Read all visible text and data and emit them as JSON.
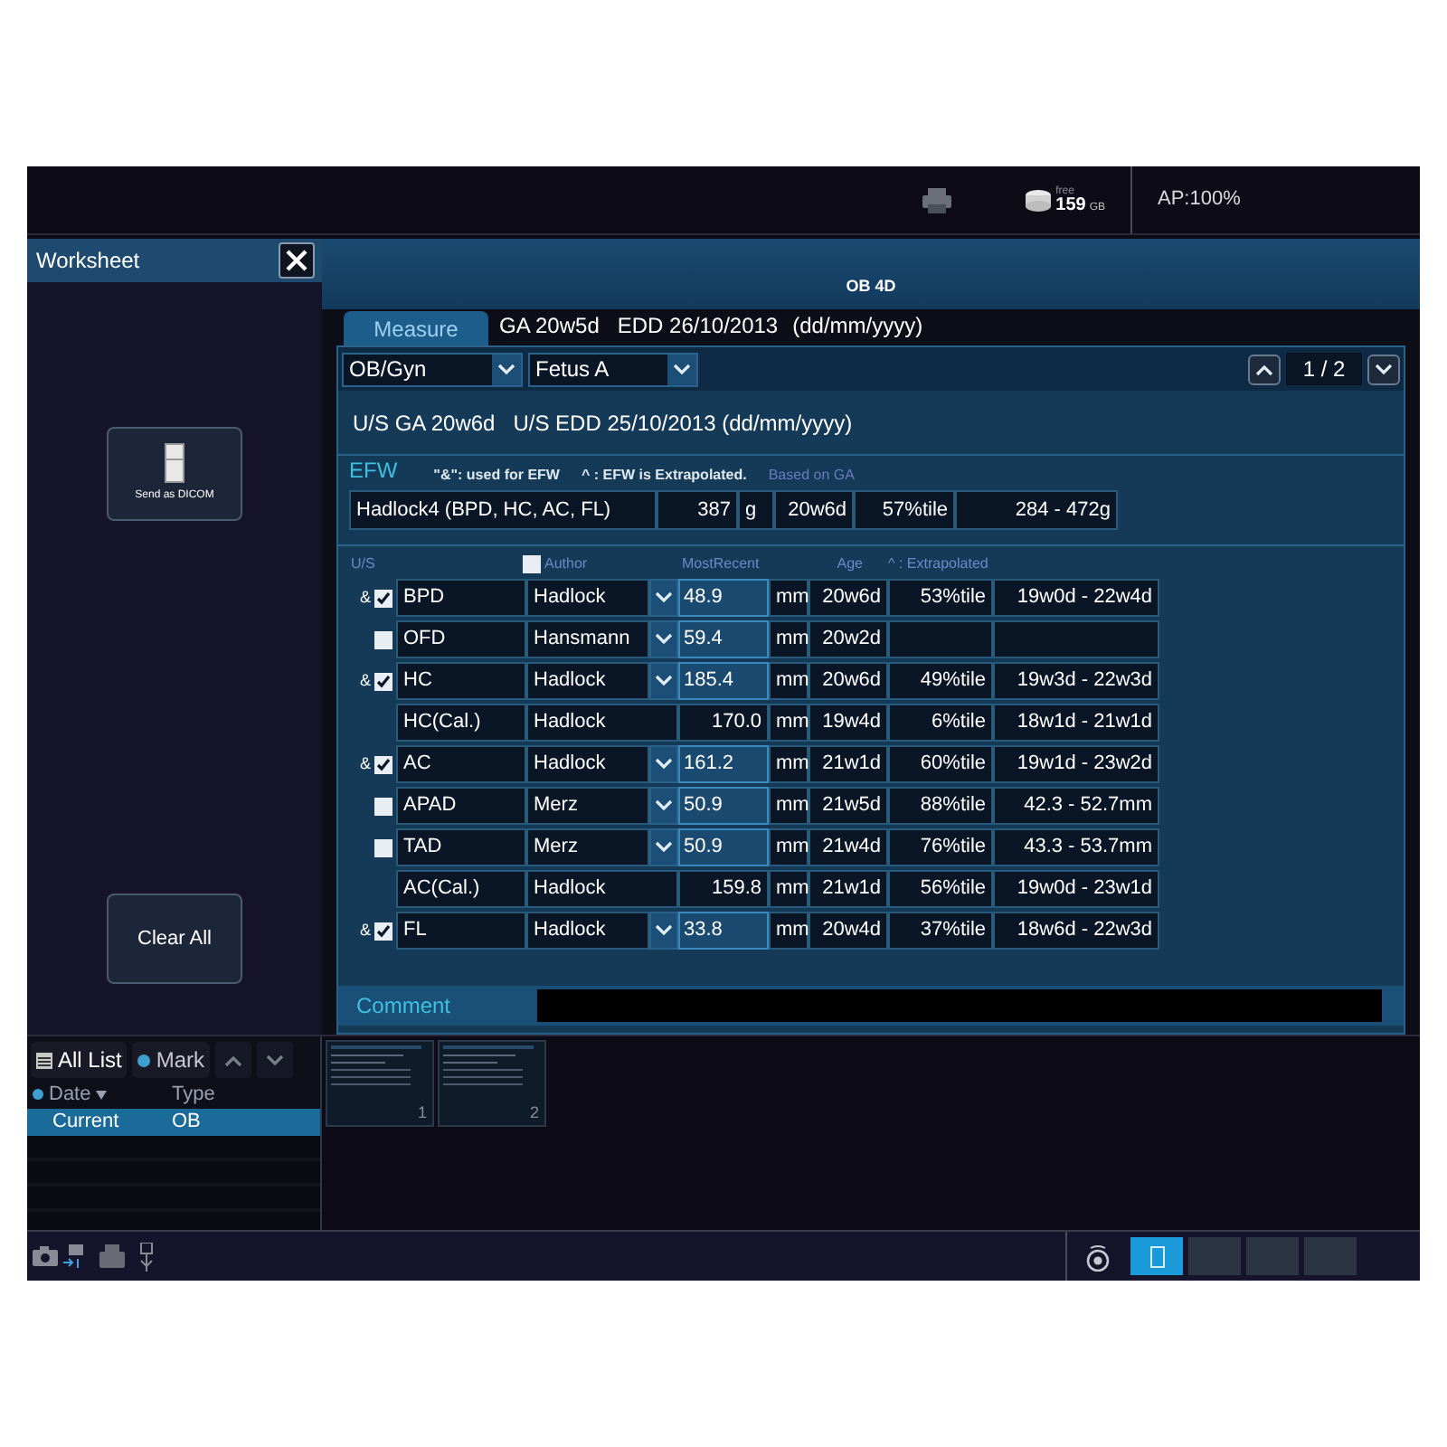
{
  "top_bar": {
    "storage_label": "free",
    "storage_value": "159",
    "storage_unit": "GB",
    "power": "AP:100%"
  },
  "worksheet": {
    "title": "Worksheet",
    "send_button": "Send as DICOM",
    "clear_button": "Clear All"
  },
  "history": {
    "all_list": "All List",
    "mark": "Mark",
    "columns": [
      "Date",
      "Type"
    ],
    "rows": [
      {
        "date": "Current",
        "type": "OB",
        "selected": true
      }
    ]
  },
  "thumbnails": [
    {
      "number": "1",
      "selected": false
    },
    {
      "number": "2",
      "selected": false
    }
  ],
  "main": {
    "title": "OB 4D",
    "tab": {
      "label": "Measure",
      "selected": true
    },
    "ga": "GA 20w5d",
    "edd": "EDD 26/10/2013",
    "date_format": "(dd/mm/yyyy)",
    "dropdowns": [
      "OB/Gyn",
      "Fetus A"
    ],
    "page": "1 / 2",
    "us_line": "U/S GA 20w6d   U/S EDD 25/10/2013 (dd/mm/yyyy)",
    "efw": {
      "title": "EFW",
      "note_used": "\"&\": used for EFW",
      "note_extrapolated": "^ : EFW is Extrapolated.",
      "basis": "Based on GA",
      "row": {
        "method": "Hadlock4 (BPD, HC, AC, FL)",
        "value": "387",
        "unit": "g",
        "age": "20w6d",
        "percentile": "57%tile",
        "range": "284 - 472g"
      }
    },
    "table": {
      "headers": {
        "us": "U/S",
        "author": "Author",
        "author_checked": false,
        "recent": "MostRecent",
        "age": "Age",
        "extrapolated": "^ : Extrapolated"
      },
      "rows": [
        {
          "kind": "measured",
          "mark": "&",
          "checked": true,
          "name": "BPD",
          "author": "Hadlock",
          "value": "48.9",
          "unit": "mm",
          "age": "20w6d",
          "percentile": "53%tile",
          "range": "19w0d - 22w4d"
        },
        {
          "kind": "measured",
          "checked": false,
          "name": "OFD",
          "author": "Hansmann",
          "value": "59.4",
          "unit": "mm",
          "age": "20w2d"
        },
        {
          "kind": "measured",
          "mark": "&",
          "checked": true,
          "name": "HC",
          "author": "Hadlock",
          "value": "185.4",
          "unit": "mm",
          "age": "20w6d",
          "percentile": "49%tile",
          "range": "19w3d - 22w3d"
        },
        {
          "kind": "calculated",
          "name": "HC(Cal.)",
          "author": "Hadlock",
          "value": "170.0",
          "unit": "mm",
          "age": "19w4d",
          "percentile": "6%tile",
          "range": "18w1d - 21w1d"
        },
        {
          "kind": "measured",
          "mark": "&",
          "checked": true,
          "name": "AC",
          "author": "Hadlock",
          "value": "161.2",
          "unit": "mm",
          "age": "21w1d",
          "percentile": "60%tile",
          "range": "19w1d - 23w2d"
        },
        {
          "kind": "measured",
          "checked": false,
          "name": "APAD",
          "author": "Merz",
          "value": "50.9",
          "unit": "mm",
          "age": "21w5d",
          "percentile": "88%tile",
          "range": "42.3 - 52.7mm"
        },
        {
          "kind": "measured",
          "checked": false,
          "name": "TAD",
          "author": "Merz",
          "value": "50.9",
          "unit": "mm",
          "age": "21w4d",
          "percentile": "76%tile",
          "range": "43.3 - 53.7mm"
        },
        {
          "kind": "calculated",
          "name": "AC(Cal.)",
          "author": "Hadlock",
          "value": "159.8",
          "unit": "mm",
          "age": "21w1d",
          "percentile": "56%tile",
          "range": "19w0d - 23w1d"
        },
        {
          "kind": "measured",
          "mark": "&",
          "checked": true,
          "name": "FL",
          "author": "Hadlock",
          "value": "33.8",
          "unit": "mm",
          "age": "20w4d",
          "percentile": "37%tile",
          "range": "18w6d - 22w3d"
        }
      ]
    },
    "comment": {
      "label": "Comment"
    }
  },
  "bottom_tabs": [
    {
      "selected": true
    },
    {
      "selected": false
    },
    {
      "selected": false
    },
    {
      "selected": false
    }
  ]
}
